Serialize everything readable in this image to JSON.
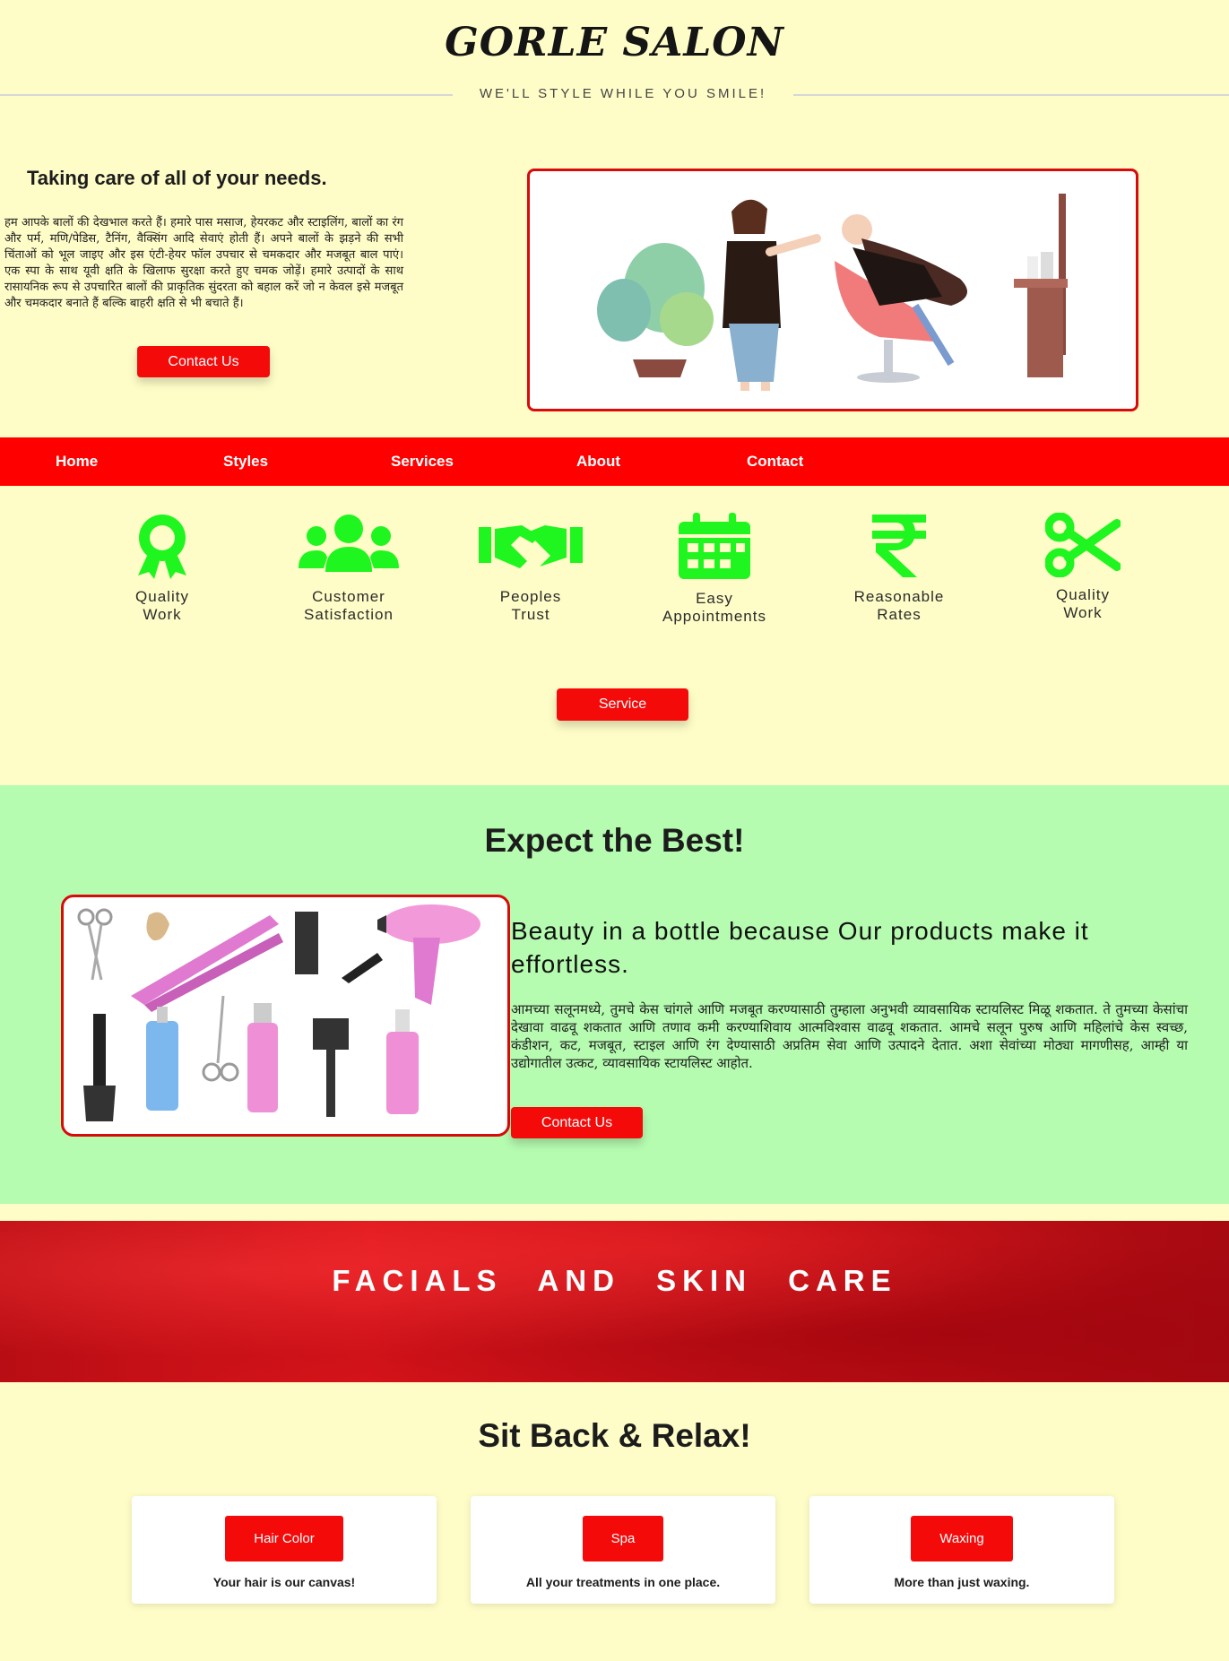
{
  "header": {
    "brand": "GORLE SALON",
    "tagline": "WE'LL STYLE WHILE YOU SMILE!"
  },
  "hero": {
    "title": "Taking care of all of your needs.",
    "text": "हम आपके बालों की देखभाल करते हैं। हमारे पास मसाज, हेयरकट और स्टाइलिंग, बालों का रंग और पर्म, मणि/पेडिस, टैनिंग, वैक्सिंग आदि सेवाएं होती हैं। अपने बालों के झड़ने की सभी चिंताओं को भूल जाइए और इस एंटी-हेयर फॉल उपचार से चमकदार और मजबूत बाल पाएं। एक स्पा के साथ यूवी क्षति के खिलाफ सुरक्षा करते हुए चमक जोड़ें। हमारे उत्पादों के साथ रासायनिक रूप से उपचारित बालों की प्राकृतिक सुंदरता को बहाल करें जो न केवल इसे मजबूत और चमकदार बनाते हैं बल्कि बाहरी क्षति से भी बचाते हैं।",
    "button": "Contact Us",
    "image_icon": "hairstylist-illustration"
  },
  "nav": {
    "items": [
      "Home",
      "Styles",
      "Services",
      "About",
      "Contact"
    ]
  },
  "features": [
    {
      "icon": "award-icon",
      "label": "Quality\nWork"
    },
    {
      "icon": "users-icon",
      "label": "Customer\nSatisfaction"
    },
    {
      "icon": "handshake-icon",
      "label": "Peoples\nTrust"
    },
    {
      "icon": "calendar-icon",
      "label": "Easy\nAppointments"
    },
    {
      "icon": "rupee-icon",
      "label": "Reasonable\nRates"
    },
    {
      "icon": "scissors-icon",
      "label": "Quality\nWork"
    }
  ],
  "service_button": "Service",
  "expect": {
    "title": "Expect the Best!",
    "subtitle": "Beauty in a bottle because Our products make it effortless.",
    "text": "आमच्या सलूनमध्ये, तुमचे केस चांगले आणि मजबूत करण्यासाठी तुम्हाला अनुभवी व्यावसायिक स्टायलिस्ट मिळू शकतात. ते तुमच्या केसांचा देखावा वाढवू शकतात आणि तणाव कमी करण्याशिवाय आत्मविश्वास वाढवू शकतात. आमचे सलून पुरुष आणि महिलांचे केस स्वच्छ, कंडीशन, कट, मजबूत, स्टाइल आणि रंग देण्यासाठी अप्रतिम सेवा आणि उत्पादने देतात. अशा सेवांच्या मोठ्या मागणीसह, आम्ही या उद्योगातील उत्कट, व्यावसायिक स्टायलिस्ट आहोत.",
    "button": "Contact Us",
    "image_icon": "salon-tools-image"
  },
  "banner": {
    "text": "FACIALS AND SKIN CARE"
  },
  "relax": {
    "title": "Sit Back & Relax!",
    "cards": [
      {
        "button": "Hair Color",
        "text": "Your hair is our canvas!"
      },
      {
        "button": "Spa",
        "text": "All your treatments in one place."
      },
      {
        "button": "Waxing",
        "text": "More than just waxing."
      }
    ]
  },
  "colors": {
    "background": "#FFFDC7",
    "accent_red": "#FF0000",
    "feature_green": "#1FF51F",
    "expect_bg": "#B5FCB0"
  }
}
